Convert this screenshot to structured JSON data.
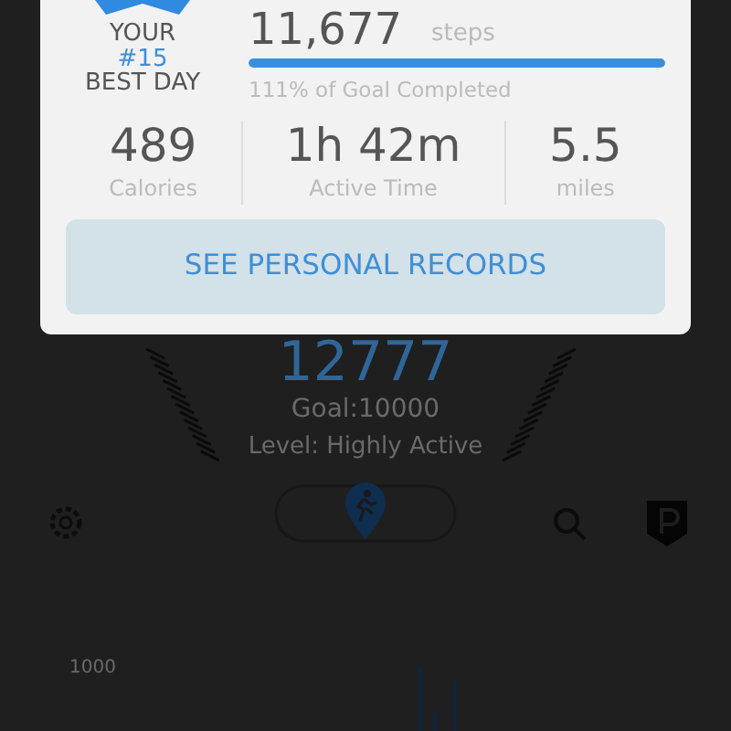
{
  "dialog": {
    "rank_badge": {
      "line_1": "YOUR",
      "rank": "#15",
      "line_2": "BEST DAY"
    },
    "steps": {
      "value": "11,677",
      "unit": "steps",
      "level": 1.0,
      "caption": "111% of Goal Completed"
    },
    "stats": [
      {
        "value": "489",
        "label": "Calories"
      },
      {
        "value": "1h 42m",
        "label": "Active Time"
      },
      {
        "value": "5.5",
        "label": "miles"
      }
    ],
    "button": "SEE PERSONAL RECORDS"
  },
  "background": {
    "step_count": "12777",
    "goal": "Goal:10000",
    "activity_level": "Level: Highly Active",
    "chart_axis_label": "1000"
  }
}
